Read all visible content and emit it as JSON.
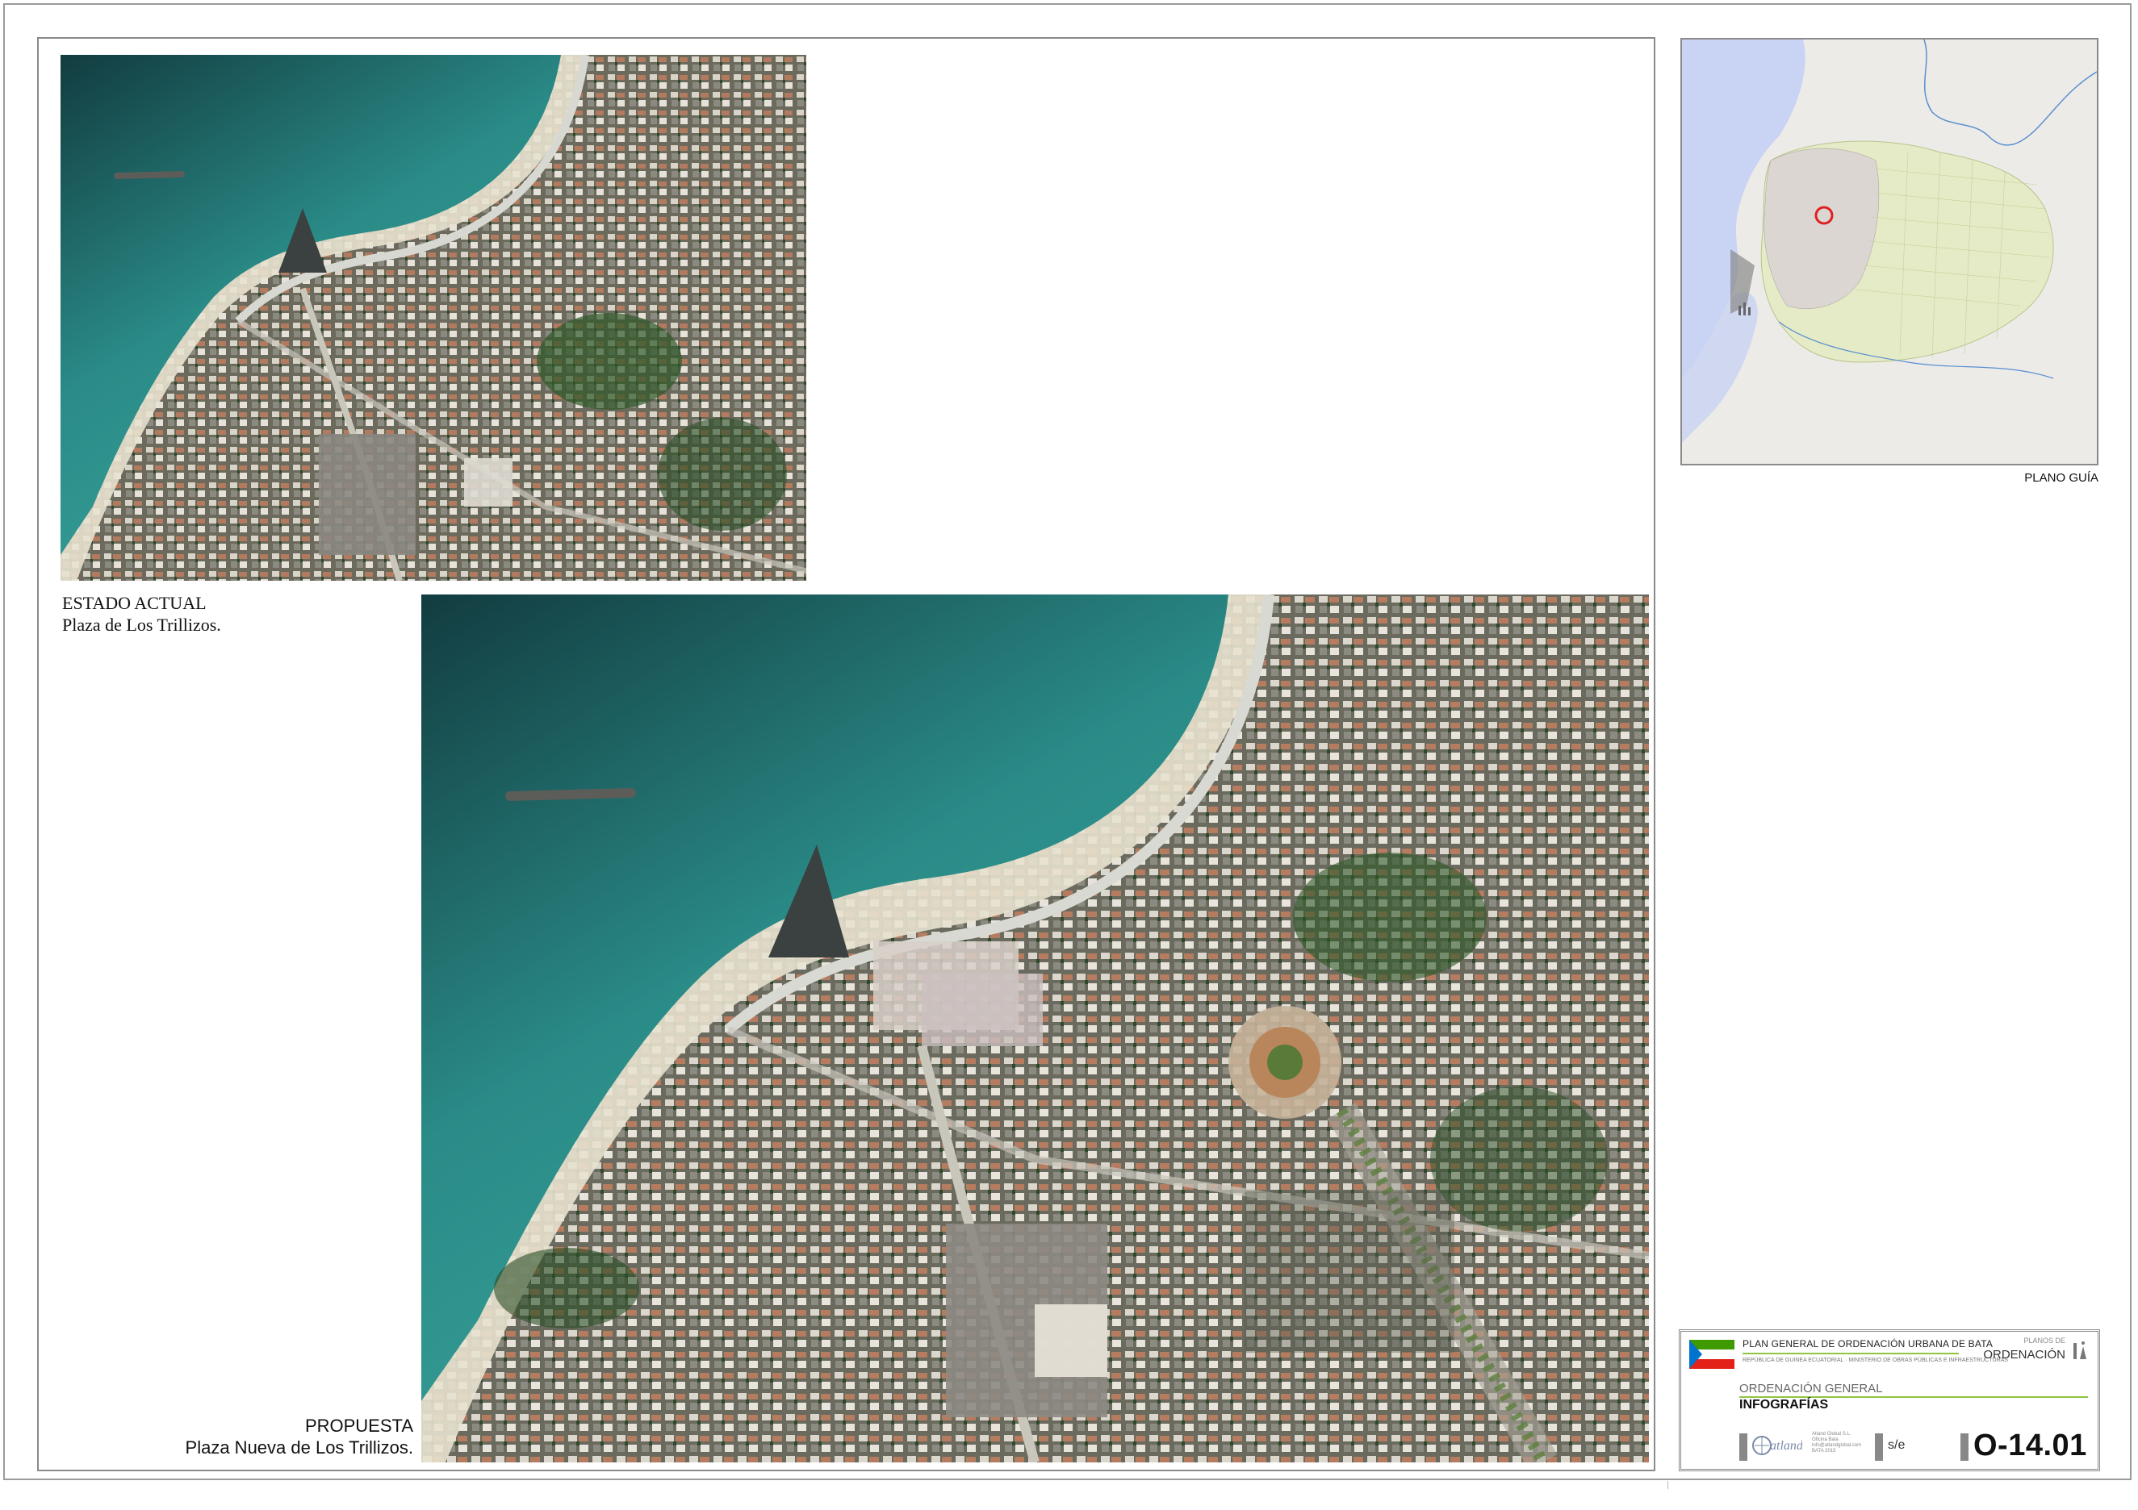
{
  "photos": {
    "current_alt": "Estado actual - vista aérea",
    "proposal_alt": "Propuesta - vista aérea"
  },
  "captions": {
    "current": {
      "line1": "ESTADO ACTUAL",
      "line2": "Plaza de Los Trillizos."
    },
    "proposal": {
      "line1": "PROPUESTA",
      "line2": "Plaza Nueva de Los Trillizos."
    }
  },
  "guide_map": {
    "label": "PLANO GUÍA"
  },
  "title_block": {
    "plan_title": "PLAN GENERAL DE ORDENACIÓN URBANA DE BATA",
    "republic_line": "REPÚBLICA DE GUINEA ECUATORIAL · MINISTERIO DE OBRAS PÚBLICAS E INFRAESTRUCTURAS",
    "planos_de": "PLANOS DE",
    "ordenacion": "ORDENACIÓN",
    "section": "ORDENACIÓN GENERAL",
    "subsection": "INFOGRAFÍAS",
    "company_small": [
      "Atland Global S.L.",
      "Oficina Bata",
      "info@atlandglobal.com",
      "BATA 2015"
    ],
    "logo_text": "atland",
    "scale": "s/e",
    "sheet_code": "O-14.01"
  },
  "colors": {
    "sea": "#2f8f8c",
    "map_water": "#c9d3f3",
    "map_land": "#ecebe8",
    "map_urban_green": "#e4ebc6",
    "map_marker": "#e02020",
    "accent_green": "#8dc63f"
  },
  "icons": {
    "flag": "equatorial-guinea-flag",
    "marker": "location-marker-icon"
  }
}
